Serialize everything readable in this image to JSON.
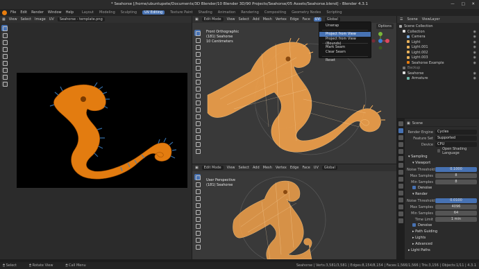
{
  "window": {
    "title": "* Seahorse [/home/ubuntupete/Documents/3D Blender/10 Blender 3D/90 Projects/Seahorse/05 Assets/Seahorse.blend] - Blender 4.3.1"
  },
  "menu": [
    "File",
    "Edit",
    "Render",
    "Window",
    "Help"
  ],
  "workspaces": [
    "Layout",
    "Modeling",
    "Sculpting",
    "UV Editing",
    "Texture Paint",
    "Shading",
    "Animation",
    "Rendering",
    "Compositing",
    "Geometry Nodes",
    "Scripting"
  ],
  "active_workspace": "UV Editing",
  "uv_editor": {
    "menus": [
      "View",
      "Select",
      "Image",
      "UV"
    ],
    "image_name": "Seahorse - template.png"
  },
  "viewport_top": {
    "mode": "Edit Mode",
    "menus": [
      "View",
      "Select",
      "Add",
      "Mesh",
      "Vertex",
      "Edge",
      "Face",
      "UV"
    ],
    "transform": "Global",
    "options": "Options",
    "info": [
      "Front Orthographic",
      "(181) Seahorse",
      "10 Centimeters"
    ]
  },
  "uv_menu": {
    "items": [
      "Unwrap",
      "Project from View",
      "Project from View (Bounds)",
      "Mark Seam",
      "Clear Seam",
      "Reset"
    ],
    "highlighted": "Project from View"
  },
  "viewport_bottom": {
    "mode": "Edit Mode",
    "menus": [
      "View",
      "Select",
      "Add",
      "Mesh",
      "Vertex",
      "Edge",
      "Face",
      "UV"
    ],
    "transform": "Global",
    "info": [
      "User Perspective",
      "(181) Seahorse"
    ]
  },
  "outliner": {
    "header": [
      "Scene",
      "ViewLayer"
    ],
    "items": [
      {
        "label": "Scene Collection",
        "color": "#aaaaaa"
      },
      {
        "label": "Collection",
        "color": "#dddddd"
      },
      {
        "label": "Camera",
        "color": "#7aa7d8"
      },
      {
        "label": "Light",
        "color": "#e8b15a"
      },
      {
        "label": "Light.001",
        "color": "#e8b15a"
      },
      {
        "label": "Light.002",
        "color": "#e8b15a"
      },
      {
        "label": "Light.003",
        "color": "#e8b15a"
      },
      {
        "label": "Seahorse Example",
        "color": "#e87d0d"
      },
      {
        "label": "Backup",
        "color": "#777777"
      },
      {
        "label": "Seahorse",
        "color": "#dddddd"
      },
      {
        "label": "Armature",
        "color": "#6fb6a8"
      }
    ]
  },
  "properties": {
    "title": "Scene",
    "render_engine": {
      "label": "Render Engine",
      "value": "Cycles"
    },
    "feature_set": {
      "label": "Feature Set",
      "value": "Supported"
    },
    "device": {
      "label": "Device",
      "value": "CPU"
    },
    "osl": "Open Shading Language",
    "sampling": "Sampling",
    "viewport": "Viewport",
    "vp_noise": {
      "label": "Noise Threshold",
      "value": "0.1000"
    },
    "vp_max": {
      "label": "Max Samples",
      "value": "8"
    },
    "vp_min": {
      "label": "Min Samples",
      "value": "8"
    },
    "denoise1": "Denoise",
    "render": "Render",
    "r_noise": {
      "label": "Noise Threshold",
      "value": "0.0100"
    },
    "r_max": {
      "label": "Max Samples",
      "value": "4096"
    },
    "r_min": {
      "label": "Min Samples",
      "value": "64"
    },
    "r_time": {
      "label": "Time Limit",
      "value": "1 min"
    },
    "denoise2": "Denoise",
    "path_guiding": "Path Guiding",
    "lights": "Lights",
    "advanced": "Advanced",
    "light_paths": "Light Paths"
  },
  "status": {
    "left": [
      "Select",
      "Rotate View",
      "Call Menu"
    ],
    "right": "Seahorse | Verts:3,581/3,581 | Edges:8,154/8,154 | Faces:1,566/1,566 | Tris:3,156 | Objects:1/11 | 4.3.1"
  }
}
